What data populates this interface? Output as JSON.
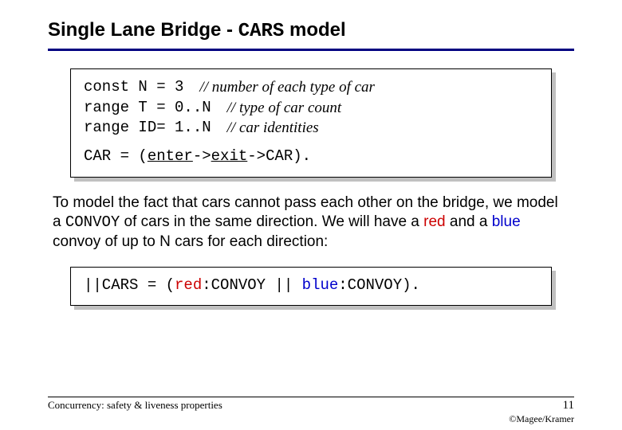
{
  "title": {
    "prefix": "Single Lane Bridge - ",
    "mono": "CARS",
    "suffix": " model"
  },
  "defs": {
    "code": [
      "const N = 3",
      "range T = 0..N",
      "range ID= 1..N"
    ],
    "comments": [
      "// number of each type of car",
      "// type of car count",
      "// car identities"
    ]
  },
  "process_line": {
    "head": "CAR = (",
    "enter": "enter",
    "arrow1": "->",
    "exit": "exit",
    "tail": "->CAR)."
  },
  "body": {
    "t1": "To model the fact that cars cannot pass each other on the bridge, we model a ",
    "convoy_mono": "CONVOY",
    "t2": " of cars in the same direction. We will have a ",
    "red_word": "red",
    "t3": " and a ",
    "blue_word": "blue",
    "t4": " convoy of up to N cars for each direction:"
  },
  "cars_line": {
    "head": "||CARS = (",
    "red": "red",
    "sep1": ":CONVOY || ",
    "blue": "blue",
    "tail": ":CONVOY)."
  },
  "footer": {
    "left": "Concurrency: safety & liveness properties",
    "page": "11",
    "credit": "©Magee/Kramer"
  }
}
